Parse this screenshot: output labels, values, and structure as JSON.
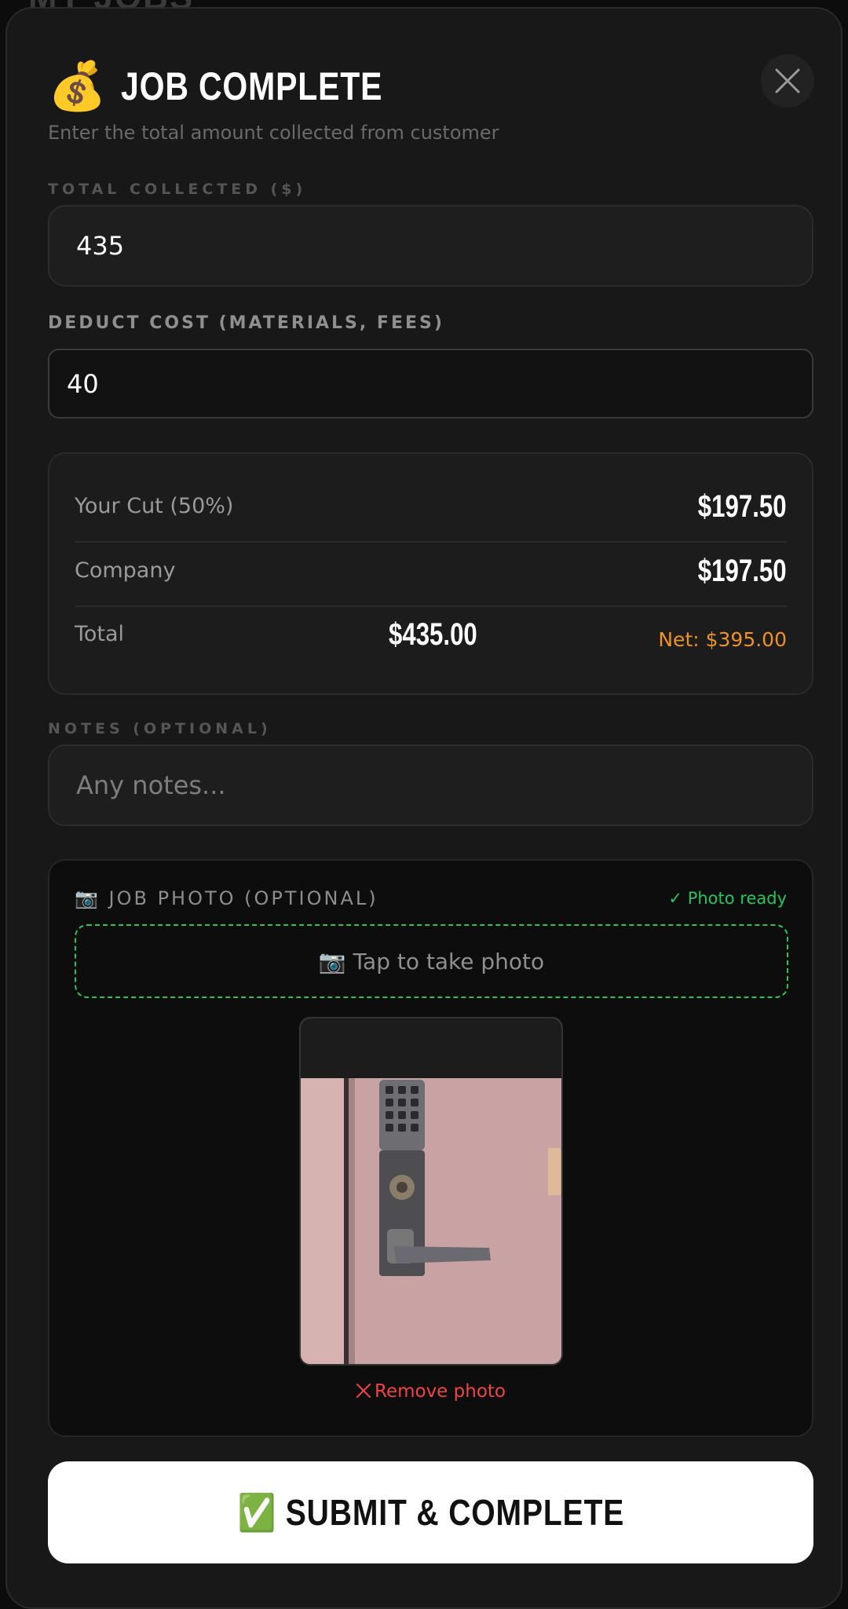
{
  "background": {
    "peek_text": "MY JOBS"
  },
  "modal": {
    "title_icon": "💰",
    "title": "JOB COMPLETE",
    "subtitle": "Enter the total amount collected from customer",
    "close_icon": "close-icon"
  },
  "total_collected": {
    "label": "TOTAL COLLECTED ($)",
    "value": "435"
  },
  "deduct_cost": {
    "label": "DEDUCT COST (MATERIALS, FEES)",
    "value": "40"
  },
  "summary": {
    "your_cut_label": "Your Cut (50%)",
    "your_cut_value": "$197.50",
    "company_label": "Company",
    "company_value": "$197.50",
    "total_label": "Total",
    "total_value": "$435.00",
    "net": "Net: $395.00"
  },
  "notes": {
    "label": "NOTES (OPTIONAL)",
    "placeholder": "Any notes..."
  },
  "photo": {
    "header": "📷 JOB PHOTO (OPTIONAL)",
    "status": "✓ Photo ready",
    "tap_label": "📷 Tap to take photo",
    "remove_label": "Remove photo"
  },
  "submit": {
    "label": "✅ SUBMIT & COMPLETE"
  },
  "colors": {
    "accent_green": "#22c55e",
    "net_orange": "#f0921e",
    "danger_red": "#ef4444",
    "sheet_bg": "#181818"
  }
}
